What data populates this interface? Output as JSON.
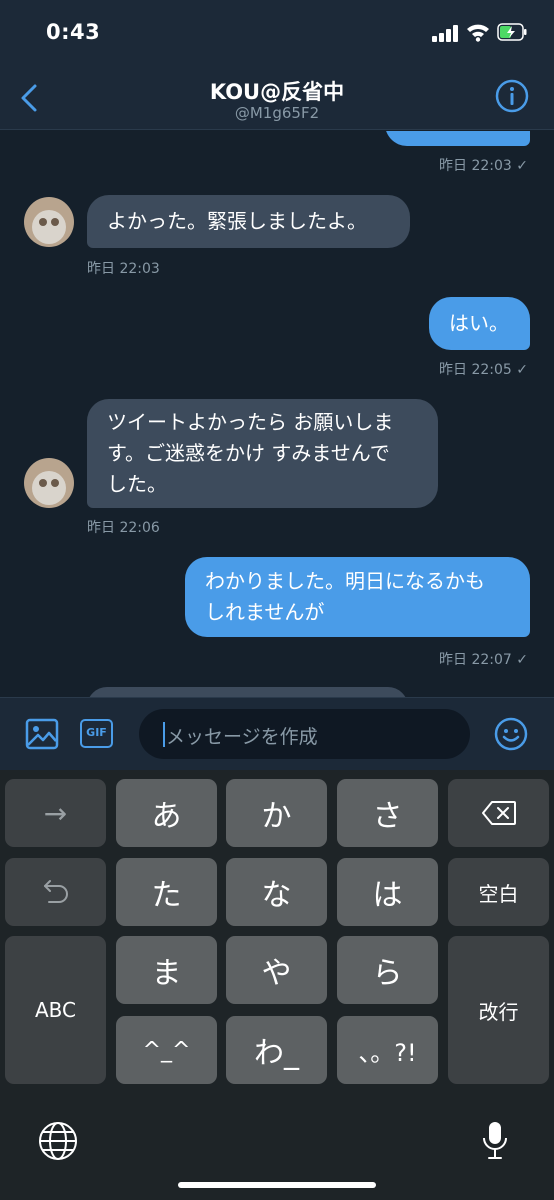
{
  "status": {
    "time": "0:43"
  },
  "header": {
    "name": "KOU@反省中",
    "handle": "@M1g65F2"
  },
  "messages": [
    {
      "dir": "out",
      "text": "",
      "meta": "昨日 22:03 ✓"
    },
    {
      "dir": "in",
      "lines": [
        "よかった。緊張しましたよ。"
      ],
      "meta": "昨日 22:03"
    },
    {
      "dir": "out",
      "lines": [
        "はい。"
      ],
      "meta": "昨日 22:05 ✓"
    },
    {
      "dir": "in",
      "lines": [
        "ツイートよかったら お願いしま",
        "す。ご迷惑をかけ すみませんで",
        "した。"
      ],
      "meta": "昨日 22:06"
    },
    {
      "dir": "out",
      "lines": [
        "わかりました。明日になるかも",
        "しれませんが"
      ],
      "meta": "昨日 22:07 ✓"
    }
  ],
  "composer": {
    "placeholder": "メッセージを作成",
    "gif_label": "GIF"
  },
  "keyboard": {
    "arrow": "→",
    "a": "あ",
    "ka": "か",
    "sa": "さ",
    "ta": "た",
    "na": "な",
    "ha": "は",
    "space": "空白",
    "abc": "ABC",
    "ma": "ま",
    "ya": "や",
    "ra": "ら",
    "enter": "改行",
    "kaomoji": "^_^",
    "wa": "わ_",
    "punct": "、。?!"
  },
  "colors": {
    "background": "#15202b",
    "bar": "#1c2938",
    "accent": "#4a9ce8",
    "incoming": "#3d4b5c",
    "key": "#5d6163",
    "key_fn": "#3d4144"
  },
  "icons": [
    "back-chevron-icon",
    "info-icon",
    "image-icon",
    "gif-icon",
    "emoji-icon",
    "backspace-icon",
    "undo-icon",
    "globe-icon",
    "microphone-icon"
  ]
}
